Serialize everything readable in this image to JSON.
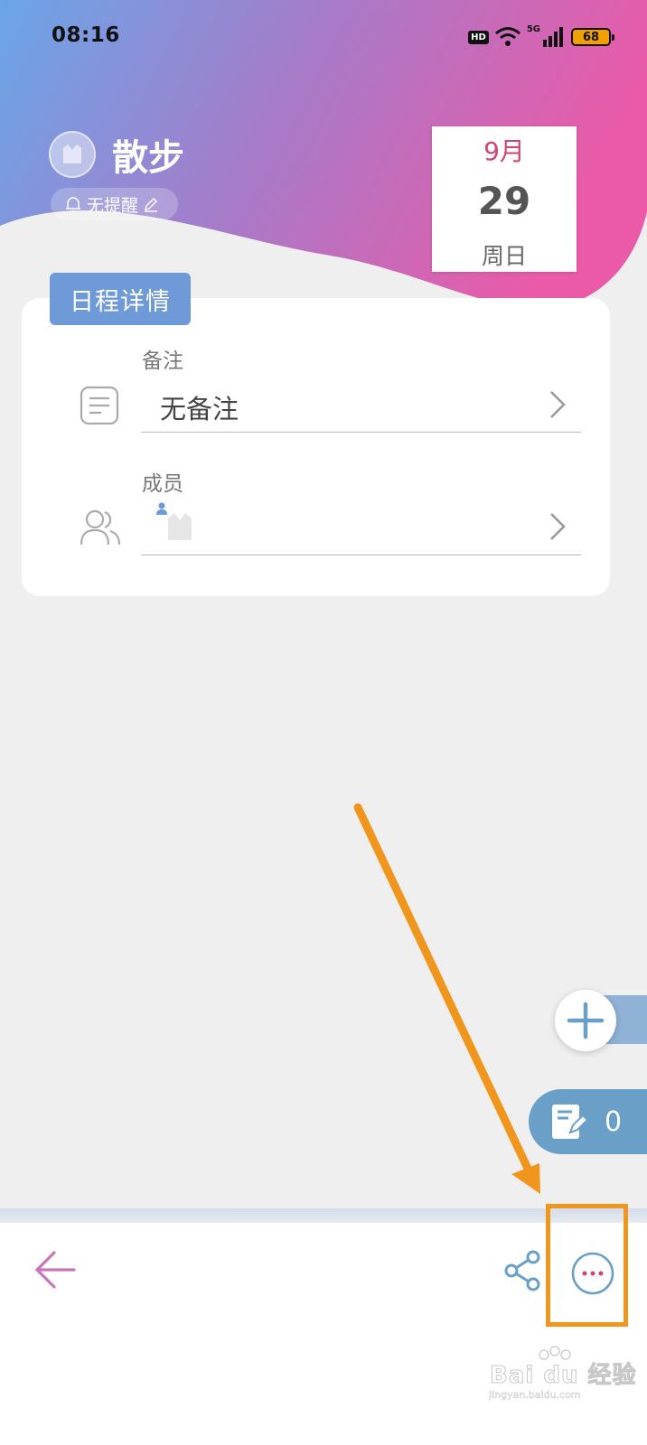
{
  "status_bar": {
    "time": "08:16",
    "hd": "HD",
    "network": "5G",
    "battery": "68"
  },
  "event": {
    "title": "散步",
    "reminder": "无提醒"
  },
  "date": {
    "month": "9月",
    "day": "29",
    "weekday": "周日"
  },
  "details": {
    "section_title": "日程详情",
    "note_label": "备注",
    "note_value": "无备注",
    "members_label": "成员"
  },
  "fab": {
    "notes_count": "0"
  },
  "watermark": {
    "brand": "Bai du 经验",
    "url": "jingyan.baidu.com"
  },
  "colors": {
    "header_left": "#6aa6e8",
    "header_mid": "#a87ac8",
    "header_right": "#ea5aa8",
    "accent_blue": "#6f9ad8",
    "month_red": "#d0456f",
    "back_arrow": "#c975b8",
    "highlight": "#f0961c"
  },
  "icons": [
    "bell-icon",
    "edit-pencil-icon",
    "note-icon",
    "members-icon",
    "chevron-right-icon",
    "plus-icon",
    "notes-edit-icon",
    "back-arrow-icon",
    "share-icon",
    "more-icon"
  ]
}
